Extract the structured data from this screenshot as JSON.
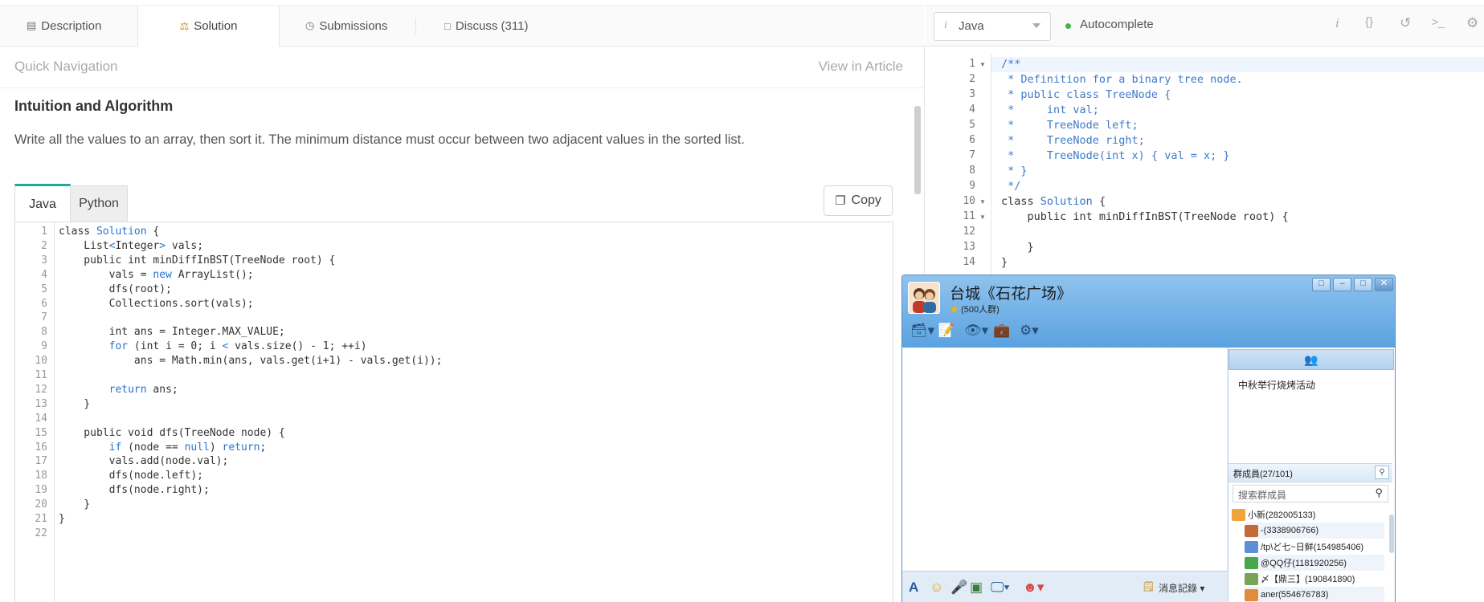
{
  "top_tabs": {
    "description": "Description",
    "solution": "Solution",
    "submissions": "Submissions",
    "discuss": "Discuss (311)"
  },
  "quick_nav": {
    "label": "Quick Navigation",
    "view_article": "View in Article"
  },
  "article": {
    "heading": "Intuition and Algorithm",
    "description": "Write all the values to an array, then sort it. The minimum distance must occur between two adjacent values in the sorted list."
  },
  "code_tabs": {
    "java": "Java",
    "python": "Python"
  },
  "copy_button": "Copy",
  "solution_code": {
    "line_numbers": [
      "1",
      "2",
      "3",
      "4",
      "5",
      "6",
      "7",
      "8",
      "9",
      "10",
      "11",
      "12",
      "13",
      "14",
      "15",
      "16",
      "17",
      "18",
      "19",
      "20",
      "21",
      "22"
    ],
    "lines": [
      "class Solution {",
      "    List<Integer> vals;",
      "    public int minDiffInBST(TreeNode root) {",
      "        vals = new ArrayList();",
      "        dfs(root);",
      "        Collections.sort(vals);",
      "",
      "        int ans = Integer.MAX_VALUE;",
      "        for (int i = 0; i < vals.size() - 1; ++i)",
      "            ans = Math.min(ans, vals.get(i+1) - vals.get(i));",
      "",
      "        return ans;",
      "    }",
      "",
      "    public void dfs(TreeNode node) {",
      "        if (node == null) return;",
      "        vals.add(node.val);",
      "        dfs(node.left);",
      "        dfs(node.right);",
      "    }",
      "}",
      ""
    ]
  },
  "editor": {
    "language": "Java",
    "language_icon": "i",
    "autocomplete": "Autocomplete",
    "toolbar_icons": [
      "info-icon",
      "braces-icon",
      "reset-icon",
      "console-icon",
      "settings-icon"
    ],
    "line_numbers": [
      "1",
      "2",
      "3",
      "4",
      "5",
      "6",
      "7",
      "8",
      "9",
      "10",
      "11",
      "12",
      "13",
      "14"
    ],
    "lines": [
      "/**",
      " * Definition for a binary tree node.",
      " * public class TreeNode {",
      " *     int val;",
      " *     TreeNode left;",
      " *     TreeNode right;",
      " *     TreeNode(int x) { val = x; }",
      " * }",
      " */",
      "class Solution {",
      "    public int minDiffInBST(TreeNode root) {",
      "",
      "    }",
      "}"
    ]
  },
  "qq_window": {
    "title": "台城《石花广场》",
    "subtitle": "(500人群)",
    "announcement": "中秋举行烧烤活动",
    "members_label": "群成員(27/101)",
    "member_search_placeholder": "搜索群成員",
    "history_label": "消息記錄",
    "members": [
      "小新(282005133)",
      "-(3338906766)",
      "/tp\\ど七~日鲜(154985406)",
      "@QQ仔(1181920256)",
      "〆【鼎三】(190841890)",
      "aner(554676783)"
    ]
  },
  "colors": {
    "accent": "#23a79a",
    "keyword": "#2a74c9",
    "comment": "#3e7bc9",
    "status_green": "#4caf50",
    "qq_blue": "#5aa2e0"
  }
}
